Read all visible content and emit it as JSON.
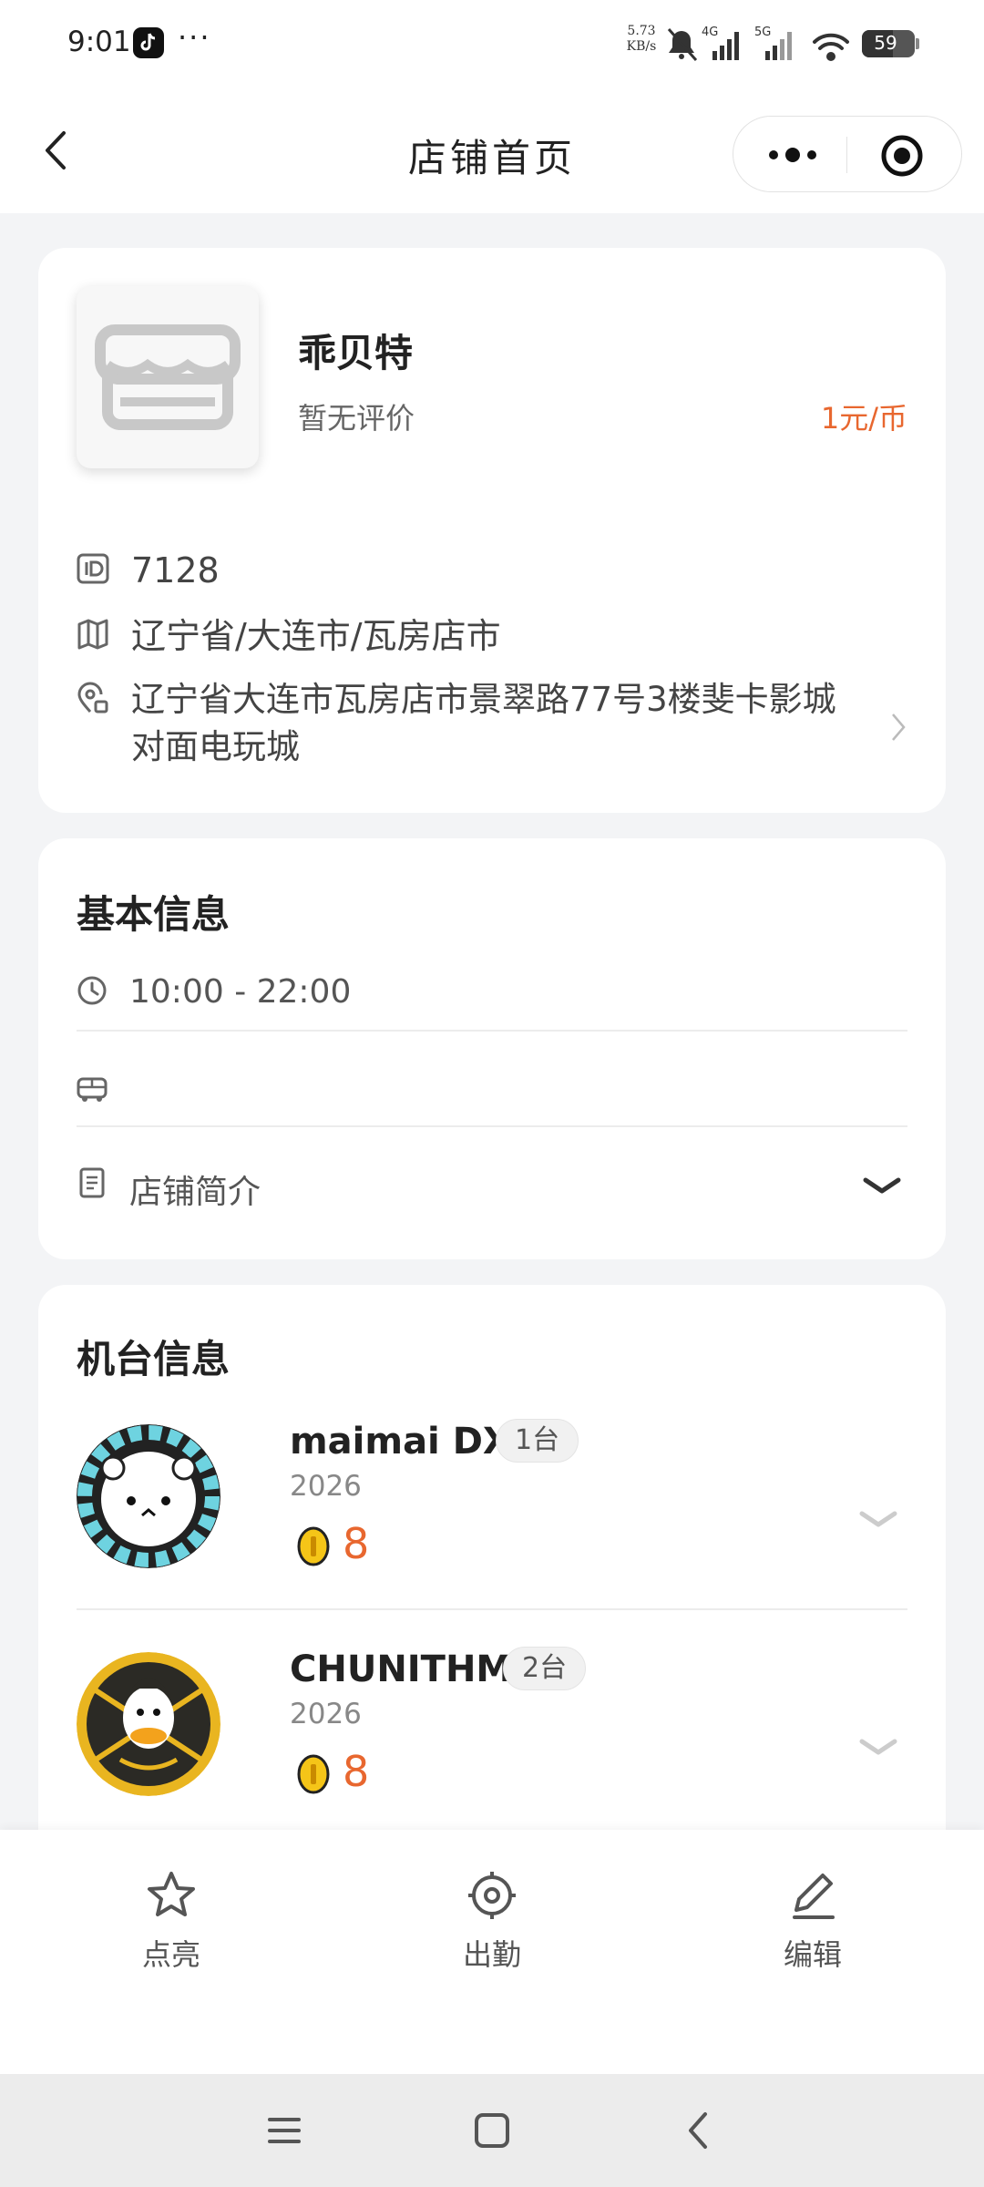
{
  "status_bar": {
    "time": "9:01",
    "more": "···",
    "net_speed": "5.73",
    "net_unit": "KB/s",
    "sig1": "4G",
    "sig2": "5G",
    "battery": "59"
  },
  "nav": {
    "title": "店铺首页"
  },
  "store": {
    "name": "乖贝特",
    "rating": "暂无评价",
    "price": "1元/币",
    "id": "7128",
    "region": "辽宁省/大连市/瓦房店市",
    "address": "辽宁省大连市瓦房店市景翠路77号3楼斐卡影城对面电玩城"
  },
  "basic_info": {
    "title": "基本信息",
    "hours": "10:00 - 22:00",
    "transport": "",
    "intro_label": "店铺简介"
  },
  "machines": {
    "title": "机台信息",
    "items": [
      {
        "name": "maimai DX",
        "count": "1台",
        "year": "2026",
        "price": "8"
      },
      {
        "name": "CHUNITHM",
        "count": "2台",
        "year": "2026",
        "price": "8"
      }
    ]
  },
  "actions": {
    "light": "点亮",
    "attend": "出勤",
    "edit": "编辑"
  },
  "colors": {
    "accent": "#e8672f",
    "background": "#f3f4f6"
  }
}
